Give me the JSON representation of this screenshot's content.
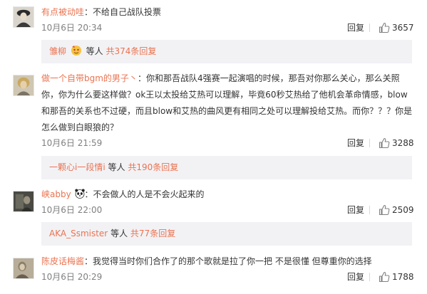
{
  "comments": [
    {
      "username": "有点被动哇",
      "separator": "：",
      "text": "不给自己战队投票",
      "time": "10月6日 20:34",
      "reply_label": "回复",
      "likes": "3657",
      "avatar_icon": "avatar-vintage-portrait-icon",
      "subreply": {
        "user": "雏柳",
        "badge_icon": "emoji-badge-icon",
        "mid": "等人",
        "count": "共374条回复"
      }
    },
    {
      "username": "做一个自带bgm的男子丶",
      "separator": "：",
      "text": "你和那吾战队4强赛一起演唱的时候，那吾对你那么关心，那么关照你，你为什么要这样做？ok王以太投给艾热可以理解，毕竟60秒艾热给了他机会革命情感，blow和那吾的关系也不过硬，而且blow和艾热的曲风更有相同之处可以理解投给艾热。而你？？？你是怎么做到白眼狼的？",
      "time": "10月6日 21:59",
      "reply_label": "回复",
      "likes": "3288",
      "avatar_icon": "avatar-blonde-person-icon",
      "subreply": {
        "user": "一颗心i一段情i",
        "mid": "等人",
        "count": "共190条回复"
      }
    },
    {
      "username": "峡abby",
      "emoji_icon": "panda-emoji-icon",
      "separator": "：",
      "text": "不会做人的人是不会火起来的",
      "time": "10月6日 22:00",
      "reply_label": "回复",
      "likes": "2509",
      "avatar_icon": "avatar-dark-photo-icon",
      "subreply": {
        "user": "AKA_Ssmister",
        "mid": "等人",
        "count": "共77条回复"
      }
    },
    {
      "username": "陈皮话梅酱",
      "separator": "：",
      "text": "我觉得当时你们合作了的那个歌就是拉了你一把 不是很懂 但尊重你的选择",
      "time": "10月6日 20:29",
      "reply_label": "回复",
      "likes": "1788",
      "avatar_icon": "avatar-sepia-photo-icon"
    }
  ],
  "colors": {
    "username": "#eb7350",
    "meta": "#808080",
    "subreply_bg": "#f2f2f5"
  }
}
